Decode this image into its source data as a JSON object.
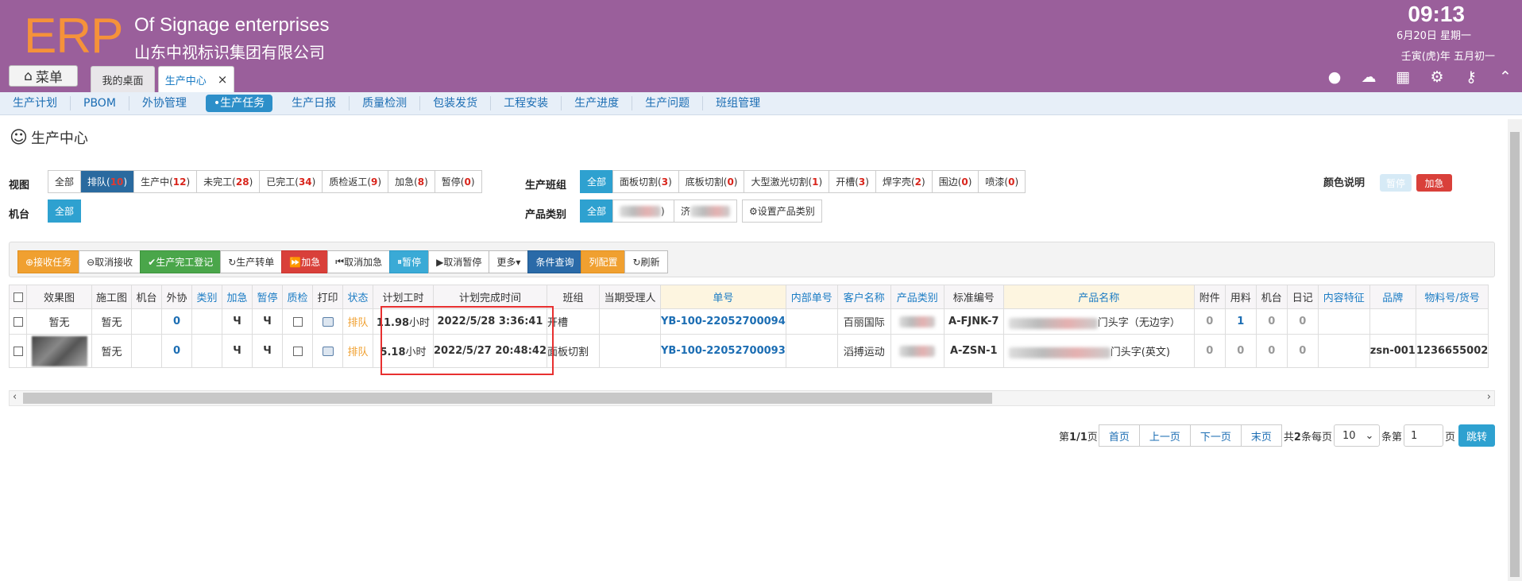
{
  "header": {
    "logo": "ERP",
    "company_en": "Of Signage enterprises",
    "company_cn": "山东中视标识集团有限公司",
    "time": "09:13",
    "date": "6月20日 星期一",
    "lunar": "壬寅(虎)年 五月初一",
    "menu_label": "菜单",
    "tabs": [
      {
        "label": "我的桌面"
      },
      {
        "label": "生产中心"
      }
    ],
    "icons": [
      "user-icon",
      "cloud-icon",
      "grid-icon",
      "gear-icon",
      "key-icon",
      "collapse-icon"
    ]
  },
  "nav": {
    "items": [
      {
        "label": "生产计划"
      },
      {
        "label": "PBOM"
      },
      {
        "label": "外协管理"
      },
      {
        "label": "•生产任务"
      },
      {
        "label": "生产日报"
      },
      {
        "label": "质量检测"
      },
      {
        "label": "包装发货"
      },
      {
        "label": "工程安装"
      },
      {
        "label": "生产进度"
      },
      {
        "label": "生产问题"
      },
      {
        "label": "班组管理"
      }
    ]
  },
  "page": {
    "title": "生产中心"
  },
  "filters": {
    "view_label": "视图",
    "machine_label": "机台",
    "team_label": "生产班组",
    "category_label": "产品类别",
    "color_label": "颜色说明",
    "legend_pause": "暂停",
    "legend_urgent": "加急",
    "view": [
      {
        "text": "全部",
        "count": ""
      },
      {
        "text": "排队(",
        "count": "10",
        "end": ")"
      },
      {
        "text": "生产中(",
        "count": "12",
        "end": ")"
      },
      {
        "text": "未完工(",
        "count": "28",
        "end": ")"
      },
      {
        "text": "已完工(",
        "count": "34",
        "end": ")"
      },
      {
        "text": "质检返工(",
        "count": "9",
        "end": ")"
      },
      {
        "text": "加急(",
        "count": "8",
        "end": ")"
      },
      {
        "text": "暂停(",
        "count": "0",
        "end": ")"
      }
    ],
    "machine_all": "全部",
    "team": [
      {
        "text": "全部"
      },
      {
        "text": "面板切割(",
        "count": "3",
        "end": ")"
      },
      {
        "text": "底板切割(",
        "count": "0",
        "end": ")"
      },
      {
        "text": "大型激光切割(",
        "count": "1",
        "end": ")"
      },
      {
        "text": "开槽(",
        "count": "3",
        "end": ")"
      },
      {
        "text": "焊字壳(",
        "count": "2",
        "end": ")"
      },
      {
        "text": "围边(",
        "count": "0",
        "end": ")"
      },
      {
        "text": "喷漆(",
        "count": "0",
        "end": ")"
      }
    ],
    "category_all": "全部",
    "category_item1_end": ")",
    "category_item2_start": "济",
    "set_category": "设置产品类别"
  },
  "toolbar": {
    "accept": "接收任务",
    "cancel_accept": "取消接收",
    "finish": "生产完工登记",
    "transfer": "生产转单",
    "urgent": "加急",
    "cancel_urgent": "取消加急",
    "pause": "暂停",
    "cancel_pause": "取消暂停",
    "more": "更多",
    "query": "条件查询",
    "columns": "列配置",
    "refresh": "刷新"
  },
  "table": {
    "headers": [
      "效果图",
      "施工图",
      "机台",
      "外协",
      "类别",
      "加急",
      "暂停",
      "质检",
      "打印",
      "状态",
      "计划工时",
      "计划完成时间",
      "班组",
      "当期受理人",
      "单号",
      "内部单号",
      "客户名称",
      "产品类别",
      "标准编号",
      "产品名称",
      "附件",
      "用料",
      "机台",
      "日记",
      "内容特征",
      "品牌",
      "物料号/货号"
    ],
    "rows": [
      {
        "effect": "暂无",
        "construction": "暂无",
        "machine": "",
        "outsource": "0",
        "type": "",
        "urgent": "Ч",
        "pause": "Ч",
        "status": "排队",
        "hours": "11.98",
        "hours_unit": "小时",
        "finish": "2022/5/28 3:36:41",
        "team": "开槽",
        "handler": "",
        "order": "YB-100-22052700094",
        "inner": "",
        "customer": "百丽国际",
        "std": "A-FJNK-7",
        "product": "门头字（无边字）",
        "attach": "0",
        "material": "1",
        "machine2": "0",
        "diary": "0",
        "feature": "",
        "brand": "",
        "sku": ""
      },
      {
        "effect": "",
        "construction": "暂无",
        "machine": "",
        "outsource": "0",
        "type": "",
        "urgent": "Ч",
        "pause": "Ч",
        "status": "排队",
        "hours": "5.18",
        "hours_unit": "小时",
        "finish": "2022/5/27 20:48:42",
        "team": "面板切割",
        "handler": "",
        "order": "YB-100-22052700093",
        "inner": "",
        "customer": "滔搏运动",
        "std": "A-ZSN-1",
        "product": "门头字(英文)",
        "attach": "0",
        "material": "0",
        "machine2": "0",
        "diary": "0",
        "feature": "",
        "brand": "zsn-001",
        "sku": "1236655002"
      }
    ]
  },
  "pager": {
    "info_pre": "第",
    "info_page": "1/1",
    "info_post": "页",
    "first": "首页",
    "prev": "上一页",
    "next": "下一页",
    "last": "末页",
    "total_pre": "共",
    "total": "2",
    "total_post": "条每页",
    "per_page": "10",
    "jump_pre": "条第",
    "page_input": "1",
    "jump_post": "页",
    "go": "跳转"
  },
  "colors": {
    "header_bg": "#9a5f9b",
    "logo": "#f5923a",
    "accent": "#2ea1d0",
    "urgent": "#d9403a"
  }
}
